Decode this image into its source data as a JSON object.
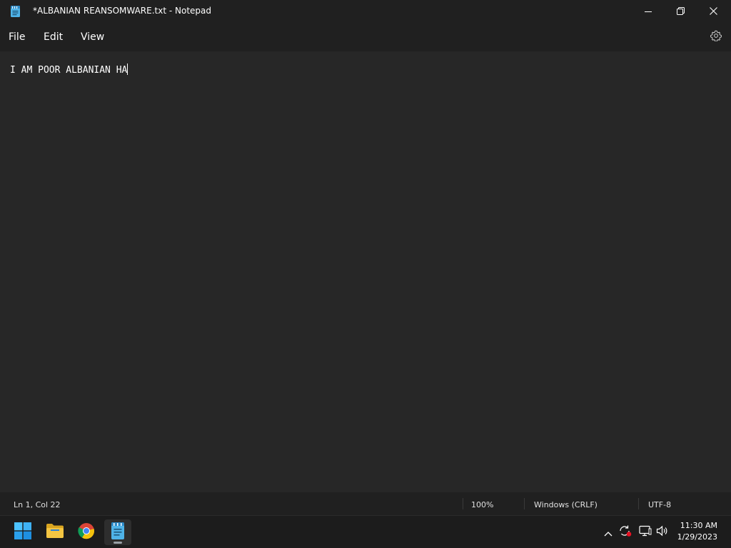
{
  "window": {
    "title": "*ALBANIAN REANSOMWARE.txt - Notepad",
    "app_icon": "notepad-icon"
  },
  "controls": {
    "minimize_icon": "minimize-icon",
    "restore_icon": "restore-icon",
    "close_icon": "close-icon"
  },
  "menu": {
    "file": "File",
    "edit": "Edit",
    "view": "View",
    "settings_icon": "gear-icon"
  },
  "editor": {
    "content": "I AM POOR ALBANIAN HA"
  },
  "status": {
    "position": "Ln 1, Col 22",
    "zoom": "100%",
    "line_ending": "Windows (CRLF)",
    "encoding": "UTF-8"
  },
  "taskbar": {
    "items": [
      {
        "name": "start-button",
        "icon": "windows-logo-icon"
      },
      {
        "name": "file-explorer",
        "icon": "folder-icon"
      },
      {
        "name": "chrome",
        "icon": "chrome-icon"
      },
      {
        "name": "notepad",
        "icon": "notepad-icon",
        "active": true
      }
    ],
    "tray": {
      "overflow_icon": "chevron-up-icon",
      "sync_icon": "sync-icon",
      "network_icon": "network-icon",
      "volume_icon": "volume-icon"
    },
    "clock": {
      "time": "11:30 AM",
      "date": "1/29/2023"
    }
  },
  "colors": {
    "editor_bg": "#272727",
    "chrome_bg": "#202020",
    "taskbar_bg": "#1c1c1c",
    "windows_blue": "#0078d4",
    "folder_yellow": "#f4c542",
    "notepad_blue": "#4fb3e8",
    "alert_red": "#e81123"
  }
}
